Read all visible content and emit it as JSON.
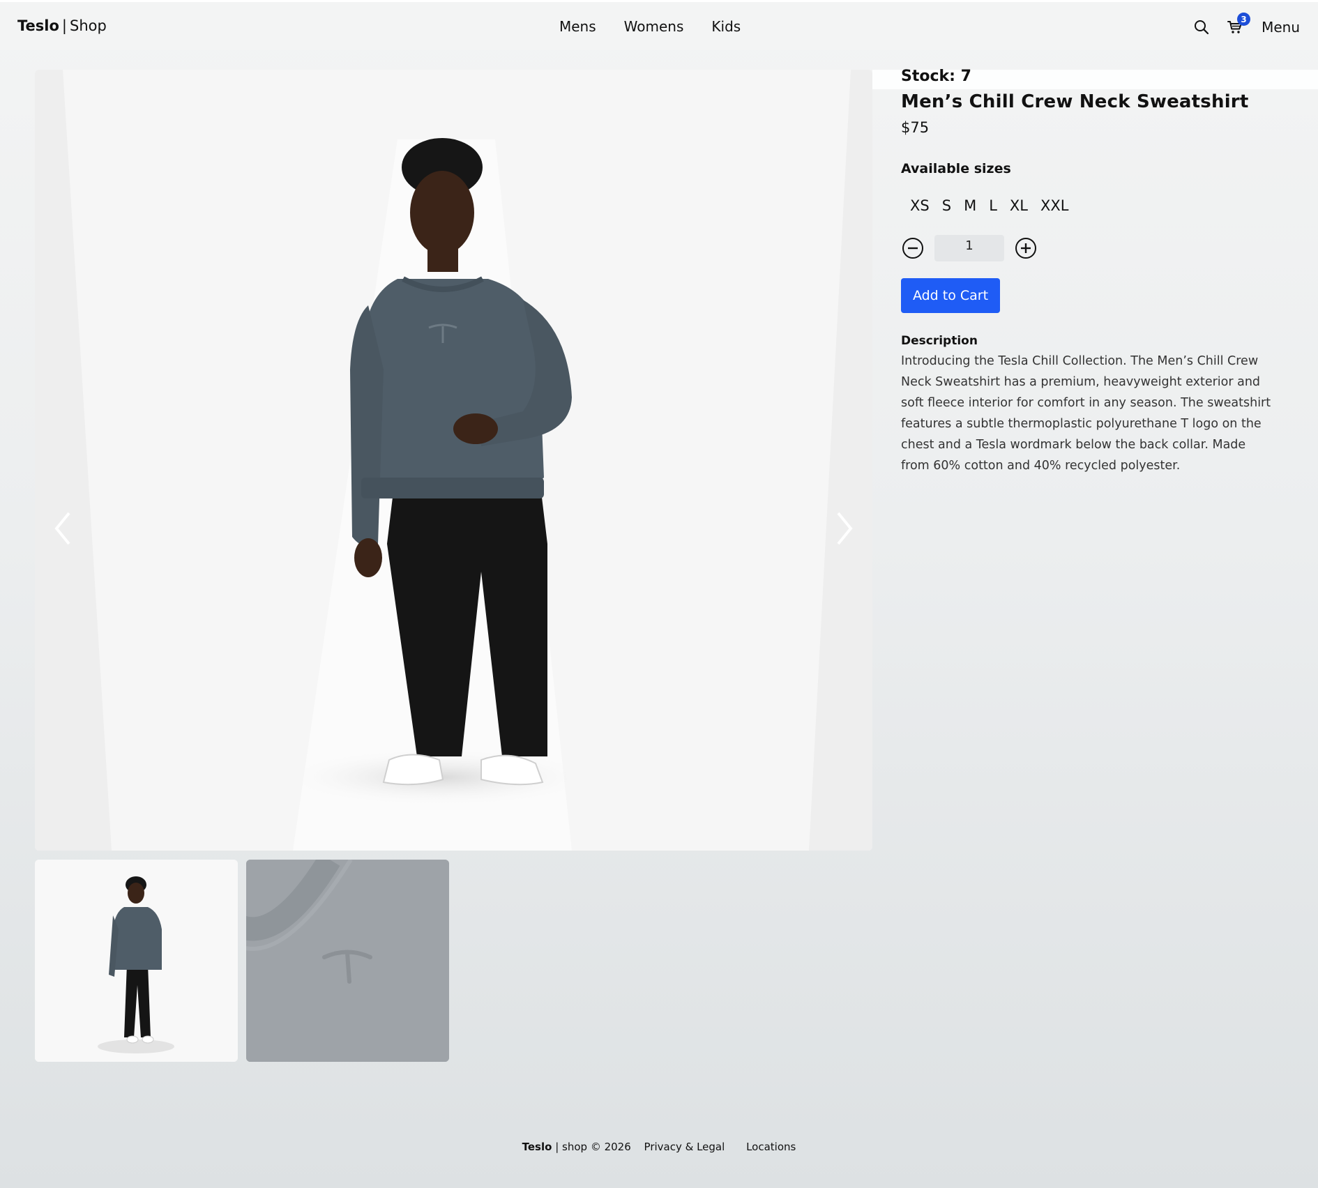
{
  "header": {
    "brand_name": "Teslo",
    "brand_separator": "|",
    "brand_suffix": "Shop",
    "nav": [
      {
        "label": "Mens"
      },
      {
        "label": "Womens"
      },
      {
        "label": "Kids"
      }
    ],
    "cart_count": "3",
    "menu_label": "Menu"
  },
  "product": {
    "stock": "Stock: 7",
    "title": "Men’s Chill Crew Neck Sweatshirt",
    "price": "$75",
    "sizes_label": "Available sizes",
    "sizes": [
      "XS",
      "S",
      "M",
      "L",
      "XL",
      "XXL"
    ],
    "quantity": "1",
    "add_to_cart": "Add to Cart",
    "description_label": "Description",
    "description": "Introducing the Tesla Chill Collection. The Men’s Chill Crew Neck Sweatshirt has a premium, heavyweight exterior and soft fleece interior for comfort in any season. The sweatshirt features a subtle thermoplastic polyurethane T logo on the chest and a Tesla wordmark below the back collar. Made from 60% cotton and 40% recycled polyester."
  },
  "footer": {
    "brand": "Teslo",
    "rest": " | shop © 2026",
    "links": [
      "Privacy & Legal",
      "Locations"
    ]
  },
  "colors": {
    "primary_button": "#1f5cf5",
    "cart_badge": "#1d4ed8",
    "sweatshirt": "#4f5d68",
    "pants": "#151515"
  }
}
